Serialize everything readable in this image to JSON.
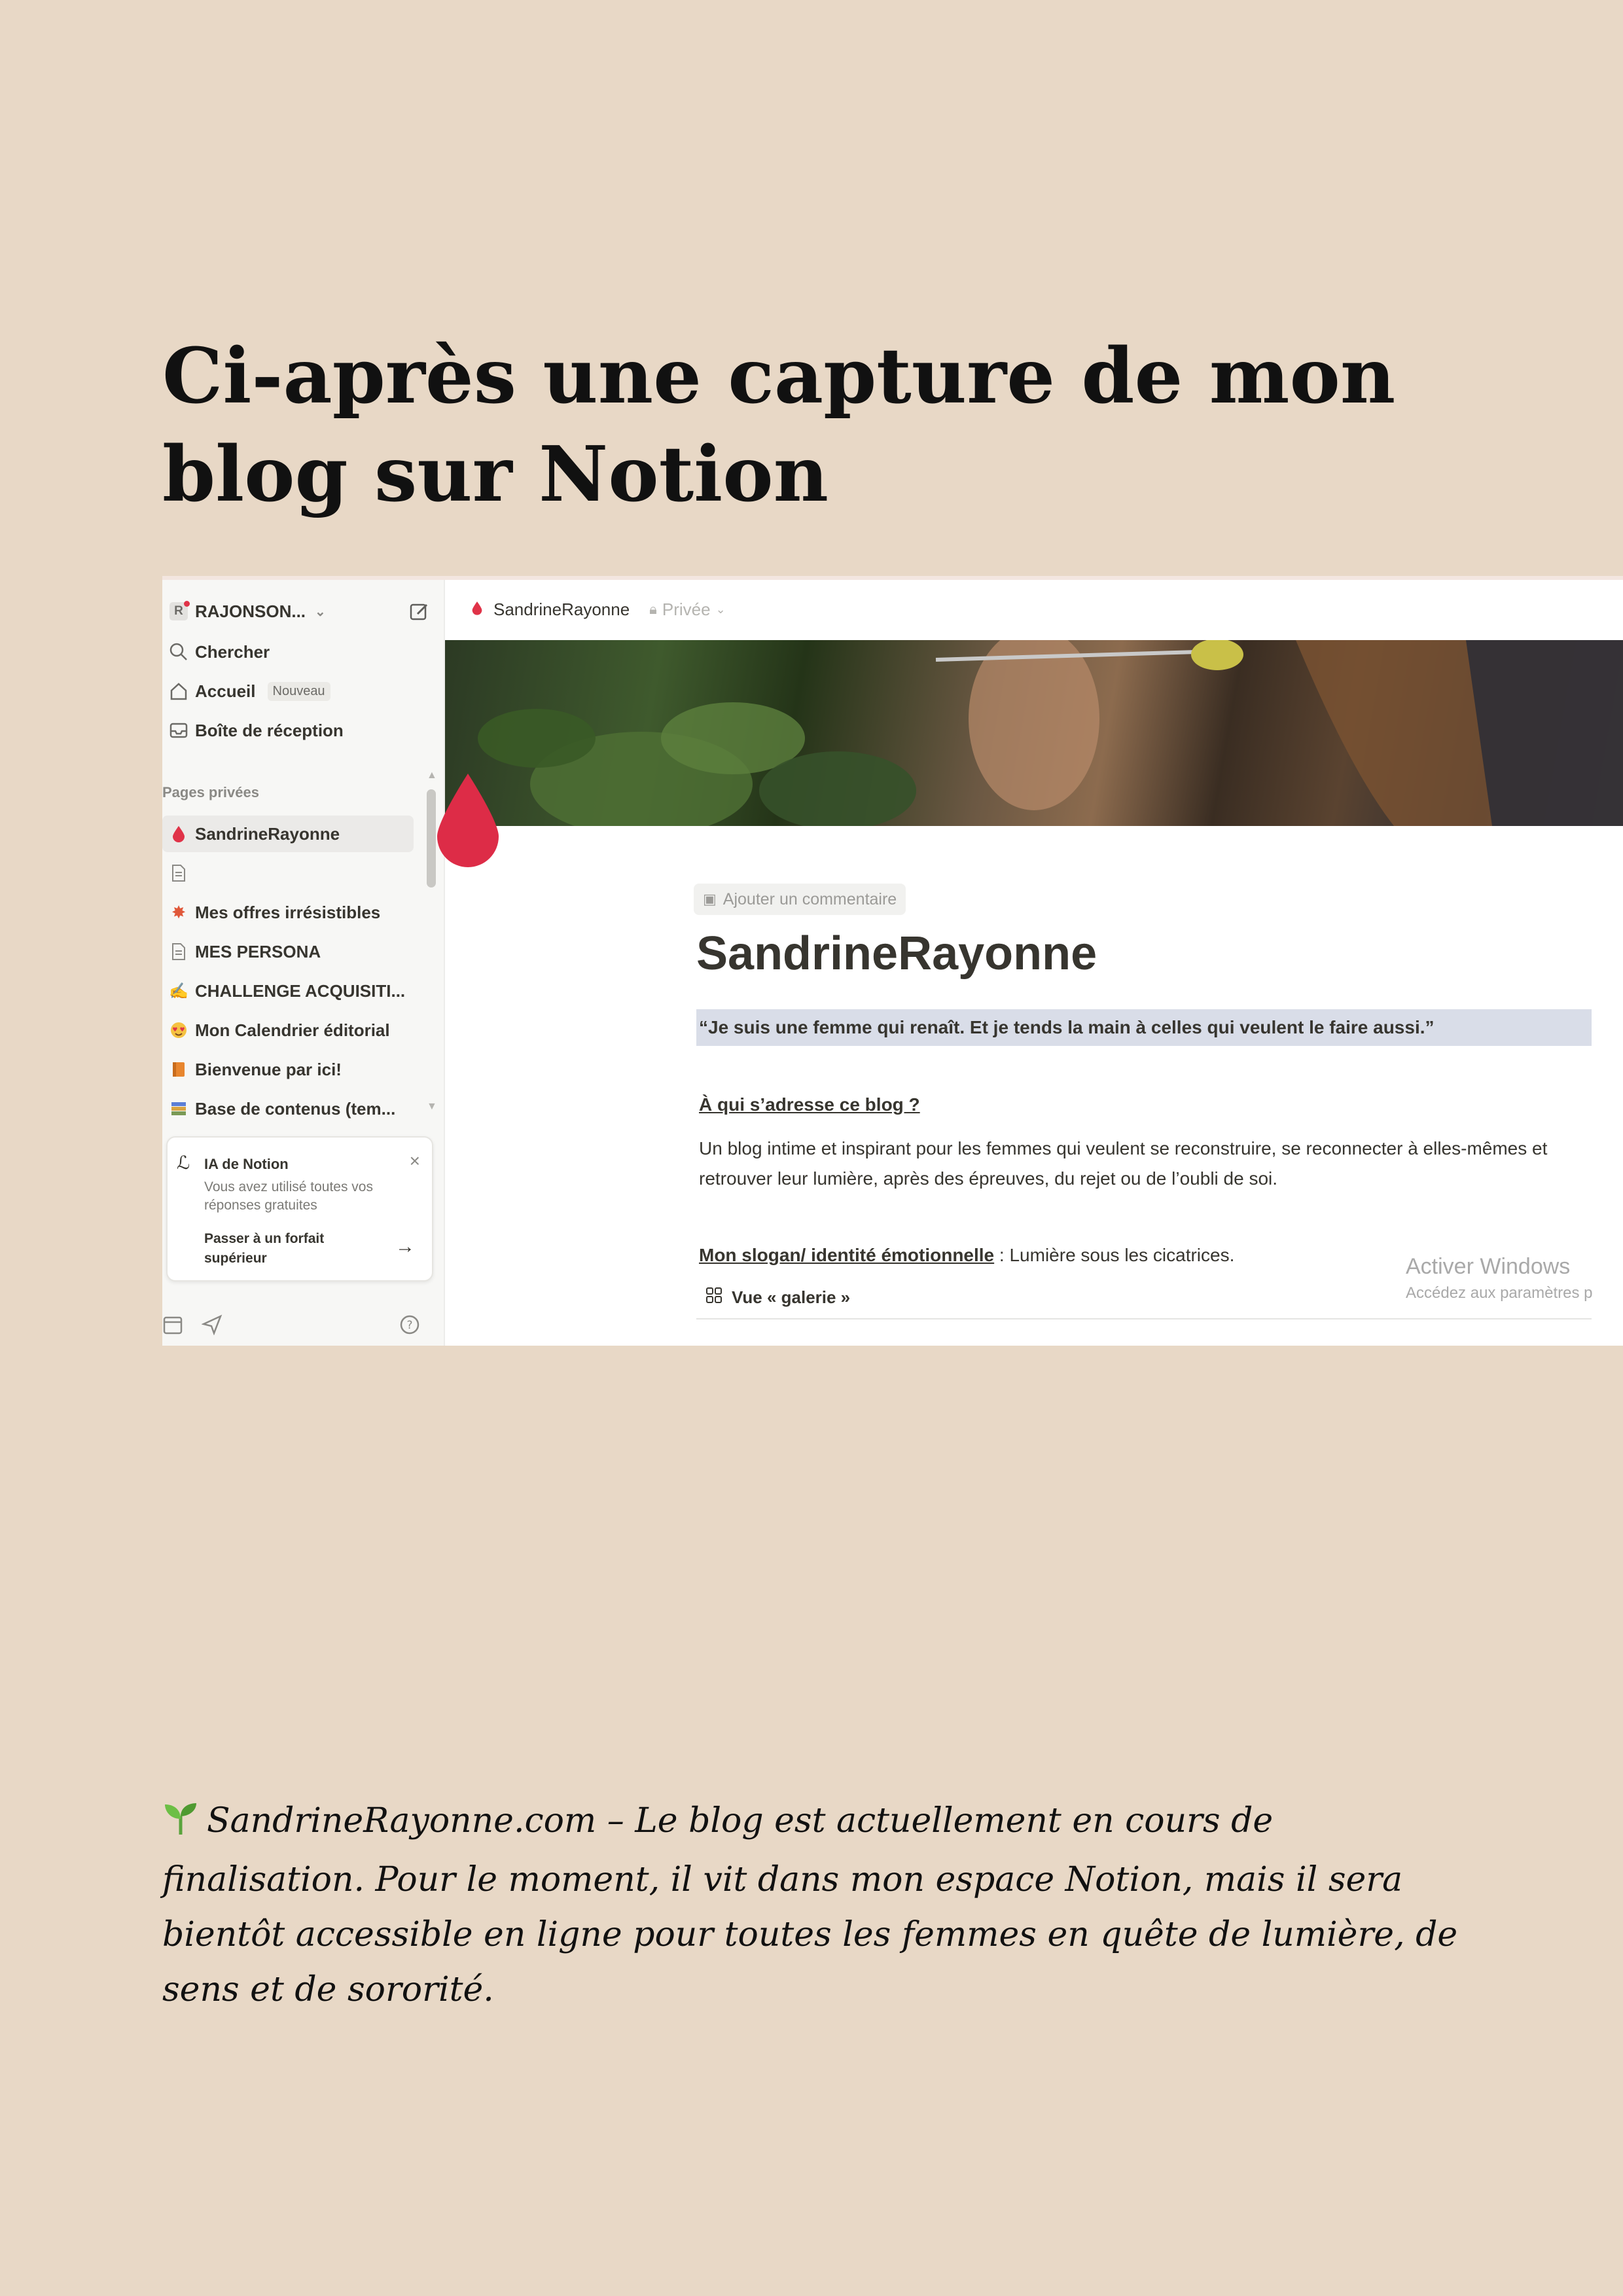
{
  "heading": "Ci-après une capture de mon blog sur Notion",
  "sidebar": {
    "workspace_initial": "R",
    "workspace_name": "RAJONSON...",
    "nav": [
      {
        "label": "Chercher"
      },
      {
        "label": "Accueil",
        "badge": "Nouveau"
      },
      {
        "label": "Boîte de réception"
      }
    ],
    "section_label": "Pages privées",
    "pages": [
      {
        "label": "SandrineRayonne",
        "icon": "drop-icon",
        "active": true
      },
      {
        "label": "",
        "icon": "page-icon"
      },
      {
        "label": "Mes offres irrésistibles",
        "icon": "burst-icon"
      },
      {
        "label": "MES PERSONA",
        "icon": "page-icon"
      },
      {
        "label": "CHALLENGE ACQUISITI...",
        "icon": "pen-icon"
      },
      {
        "label": "Mon Calendrier éditorial",
        "icon": "heart-eyes-icon"
      },
      {
        "label": "Bienvenue par ici!",
        "icon": "book-icon"
      },
      {
        "label": "Base de contenus (tem...",
        "icon": "books-icon"
      }
    ],
    "ai_card": {
      "title": "IA de Notion",
      "text": "Vous avez utilisé toutes vos réponses gratuites",
      "upgrade": "Passer à un forfait supérieur"
    }
  },
  "topbar": {
    "page_name": "SandrineRayonne",
    "privacy": "Privée"
  },
  "page": {
    "comment_button": "Ajouter un commentaire",
    "title": "SandrineRayonne",
    "quote": "“Je suis une femme qui renaît. Et je tends la main à celles qui veulent le faire aussi.”",
    "question_heading": "À qui s’adresse ce blog ?",
    "question_body": "Un blog intime et inspirant pour les femmes qui veulent se reconstruire, se reconnecter à elles-mêmes et retrouver leur lumière, après des épreuves, du rejet ou de l’oubli de soi.",
    "slogan_label": "Mon slogan/ identité émotionnelle",
    "slogan_value": " : Lumière sous les cicatrices.",
    "gallery_view": "Vue « galerie »"
  },
  "watermark": {
    "title": "Activer Windows",
    "subtitle": "Accédez aux paramètres p"
  },
  "note": "SandrineRayonne.com – Le blog est actuellement en cours de finalisation. Pour le moment, il vit dans mon espace Notion, mais il sera bientôt accessible en ligne pour toutes les femmes en quête de lumière, de sens et de sororité.",
  "colors": {
    "background": "#e8d8c6",
    "accent_red": "#e03348",
    "quote_highlight": "#d9dde8"
  }
}
